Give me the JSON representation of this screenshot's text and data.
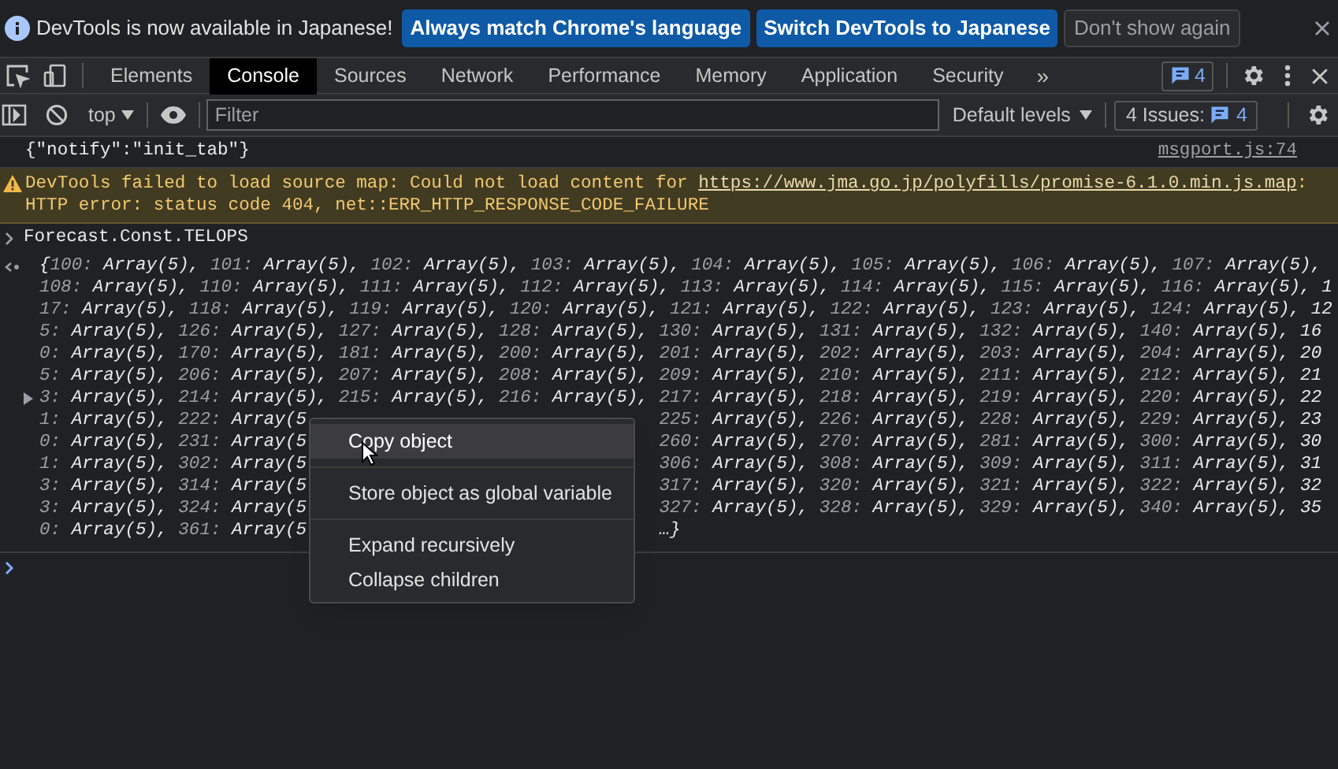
{
  "infobar": {
    "message": "DevTools is now available in Japanese!",
    "buttons": [
      {
        "label": "Always match Chrome's language",
        "kind": "primary"
      },
      {
        "label": "Switch DevTools to Japanese",
        "kind": "primary"
      },
      {
        "label": "Don't show again",
        "kind": "secondary"
      }
    ]
  },
  "tabs": [
    {
      "label": "Elements",
      "selected": false
    },
    {
      "label": "Console",
      "selected": true
    },
    {
      "label": "Sources",
      "selected": false
    },
    {
      "label": "Network",
      "selected": false
    },
    {
      "label": "Performance",
      "selected": false
    },
    {
      "label": "Memory",
      "selected": false
    },
    {
      "label": "Application",
      "selected": false
    },
    {
      "label": "Security",
      "selected": false
    }
  ],
  "more_tabs": "»",
  "issues_badge": "4",
  "toolbar": {
    "context": "top",
    "filter_placeholder": "Filter",
    "levels": "Default levels",
    "issues_label": "4 Issues:",
    "issues_count": "4"
  },
  "messages": [
    {
      "kind": "log",
      "text": "{\"notify\":\"init_tab\"}",
      "source": "msgport.js:74"
    },
    {
      "kind": "warning",
      "text": "DevTools failed to load source map: Could not load content for ",
      "link": "https://www.jma.go.jp/polyfills/promise-6.1.0.min.js.map",
      "rest": ": HTTP error: status code 404, net::ERR_HTTP_RESPONSE_CODE_FAILURE"
    },
    {
      "kind": "input",
      "text": "Forecast.Const.TELOPS"
    }
  ],
  "result": {
    "lines": [
      {
        "text": "{100: Array(5), 101: Array(5), 102: Array(5), 103: Array(5), 104: Array(5), 105: Array(5), 106: Array(5), 107: Array(5),",
        "toggle": false
      },
      {
        "text": "108: Array(5), 110: Array(5), 111: Array(5), 112: Array(5), 113: Array(5), 114: Array(5), 115: Array(5), 116: Array(5), 1",
        "toggle": false
      },
      {
        "text": "17: Array(5), 118: Array(5), 119: Array(5), 120: Array(5), 121: Array(5), 122: Array(5), 123: Array(5), 124: Array(5), 12",
        "toggle": false
      },
      {
        "text": "5: Array(5), 126: Array(5), 127: Array(5), 128: Array(5), 130: Array(5), 131: Array(5), 132: Array(5), 140: Array(5), 16",
        "toggle": false
      },
      {
        "text": "0: Array(5), 170: Array(5), 181: Array(5), 200: Array(5), 201: Array(5), 202: Array(5), 203: Array(5), 204: Array(5), 20",
        "toggle": false
      },
      {
        "text": "5: Array(5), 206: Array(5), 207: Array(5), 208: Array(5), 209: Array(5), 210: Array(5), 211: Array(5), 212: Array(5), 21",
        "toggle": false
      },
      {
        "text": "3: Array(5), 214: Array(5), 215: Array(5), 216: Array(5), 217: Array(5), 218: Array(5), 219: Array(5), 220: Array(5), 22",
        "toggle": true
      },
      {
        "left": "1: Array(5), 222: Array(5",
        "right": "225: Array(5), 226: Array(5), 228: Array(5), 229: Array(5), 23",
        "toggle": false
      },
      {
        "left": "0: Array(5), 231: Array(5",
        "right": "260: Array(5), 270: Array(5), 281: Array(5), 300: Array(5), 30",
        "toggle": false
      },
      {
        "left": "1: Array(5), 302: Array(5",
        "right": "306: Array(5), 308: Array(5), 309: Array(5), 311: Array(5), 31",
        "toggle": false
      },
      {
        "left": "3: Array(5), 314: Array(5",
        "right": "317: Array(5), 320: Array(5), 321: Array(5), 322: Array(5), 32",
        "toggle": false
      },
      {
        "left": "3: Array(5), 324: Array(5",
        "right": "327: Array(5), 328: Array(5), 329: Array(5), 340: Array(5), 35",
        "toggle": false
      },
      {
        "left": "0: Array(5), 361: Array(5",
        "right": "…}",
        "toggle": false
      }
    ]
  },
  "context_menu": {
    "groups": [
      [
        {
          "label": "Copy object",
          "selected": true
        }
      ],
      [
        {
          "label": "Store object as global variable",
          "selected": false
        }
      ],
      [
        {
          "label": "Expand recursively",
          "selected": false
        },
        {
          "label": "Collapse children",
          "selected": false
        }
      ]
    ]
  }
}
